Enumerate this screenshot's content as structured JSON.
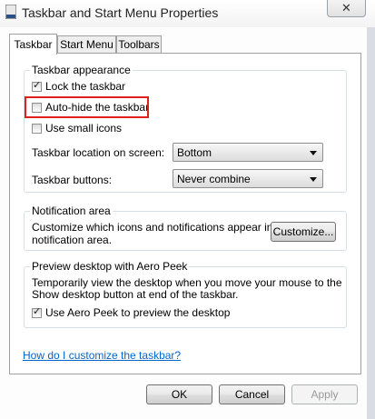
{
  "window": {
    "title": "Taskbar and Start Menu Properties",
    "close_label": "✕"
  },
  "tabs": [
    {
      "label": "Taskbar",
      "active": true
    },
    {
      "label": "Start Menu",
      "active": false
    },
    {
      "label": "Toolbars",
      "active": false
    }
  ],
  "appearance": {
    "title": "Taskbar appearance",
    "lock": {
      "label": "Lock the taskbar",
      "checked": true
    },
    "autohide": {
      "label": "Auto-hide the taskbar",
      "checked": false
    },
    "small_icons": {
      "label": "Use small icons",
      "checked": false
    },
    "location": {
      "label": "Taskbar location on screen:",
      "value": "Bottom"
    },
    "buttons": {
      "label": "Taskbar buttons:",
      "value": "Never combine"
    }
  },
  "notification": {
    "title": "Notification area",
    "text_line1": "Customize which icons and notifications appear in the",
    "text_line2": "notification area.",
    "customize_label": "Customize..."
  },
  "aero_peek": {
    "title": "Preview desktop with Aero Peek",
    "text_line1": "Temporarily view the desktop when you move your mouse to the",
    "text_line2": "Show desktop button at end of the taskbar.",
    "use": {
      "label": "Use Aero Peek to preview the desktop",
      "checked": true
    }
  },
  "help_link": "How do I customize the taskbar?",
  "footer": {
    "ok": "OK",
    "cancel": "Cancel",
    "apply": "Apply"
  },
  "colors": {
    "highlight": "#e02020",
    "link": "#0066cc"
  }
}
